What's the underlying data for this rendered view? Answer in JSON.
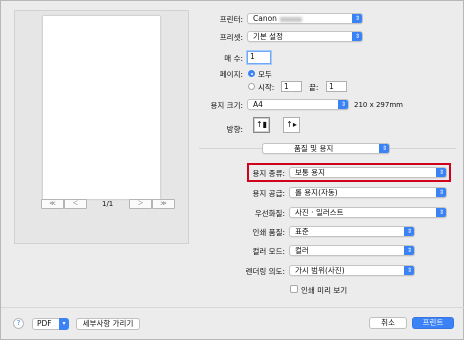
{
  "preview": {
    "page_indicator": "1/1",
    "nav_first": "≪",
    "nav_prev": "＜",
    "nav_next": "＞",
    "nav_last": "≫"
  },
  "printer": {
    "label": "프린터:",
    "value": "Canon"
  },
  "preset": {
    "label": "프리셋:",
    "value": "기본 설정"
  },
  "copies": {
    "label": "매 수:",
    "value": "1"
  },
  "pages": {
    "label": "페이지:",
    "all": "모두",
    "from_label": "시작:",
    "from_value": "1",
    "to_label": "끝:",
    "to_value": "1"
  },
  "paper_size": {
    "label": "용지 크기:",
    "value": "A4",
    "dimensions": "210 x 297mm"
  },
  "orientation": {
    "label": "방향:"
  },
  "section": {
    "value": "품질 및 용지"
  },
  "media_type": {
    "label": "용지 종류:",
    "value": "보통 용지"
  },
  "paper_source": {
    "label": "용지 공급:",
    "value": "롤 용지(자동)"
  },
  "priority": {
    "label": "우선화질:",
    "value": "사진 · 일러스트"
  },
  "print_quality": {
    "label": "인쇄 품질:",
    "value": "표준"
  },
  "color_mode": {
    "label": "컬러 모드:",
    "value": "컬러"
  },
  "rendering_intent": {
    "label": "렌더링 의도:",
    "value": "가시 범위(사진)"
  },
  "print_preview": {
    "label": "인쇄 미리 보기"
  },
  "footer": {
    "help": "?",
    "pdf": "PDF",
    "details": "세부사항 가리기",
    "cancel": "취소",
    "print": "프린트"
  },
  "colors": {
    "accent": "#3b82f6",
    "highlight": "#d0021b"
  }
}
